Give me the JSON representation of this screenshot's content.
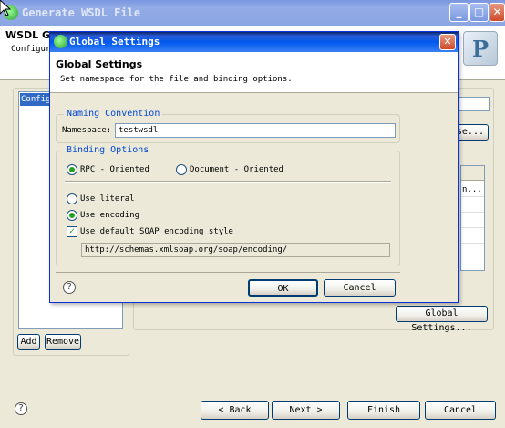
{
  "main_window": {
    "title": "Generate WSDL File",
    "header_title": "WSDL Ge",
    "header_desc": "Configur",
    "list_selected": "Config",
    "add_label": "Add",
    "remove_label": "Remove",
    "browse_label": "se...",
    "table_cell": "n...",
    "global_settings_label": "Global Settings...",
    "back_label": "< Back",
    "next_label": "Next >",
    "finish_label": "Finish",
    "cancel_label": "Cancel",
    "logo_letter": "P"
  },
  "dialog": {
    "title": "Global Settings",
    "header_title": "Global Settings",
    "header_desc": "Set namespace for the file and binding options.",
    "naming_group": "Naming Convention",
    "namespace_label": "Namespace:",
    "namespace_value": "testwsdl",
    "binding_group": "Binding Options",
    "rpc_label": "RPC - Oriented",
    "document_label": "Document - Oriented",
    "literal_label": "Use literal",
    "encoding_label": "Use encoding",
    "default_soap_label": "Use default SOAP encoding style",
    "encoding_url": "http://schemas.xmlsoap.org/soap/encoding/",
    "ok_label": "OK",
    "cancel_label": "Cancel",
    "close_glyph": "✕",
    "rpc_selected": true,
    "encoding_selected": true,
    "default_soap_checked": true
  },
  "icons": {
    "help": "?",
    "check": "✓",
    "minimize": "_",
    "maximize": "□",
    "close": "✕"
  },
  "colors": {
    "titlebar_active": "#0058ee",
    "titlebar_inactive": "#8aa6e2",
    "group_label": "#0046d5",
    "window_bg": "#ece9d8"
  }
}
